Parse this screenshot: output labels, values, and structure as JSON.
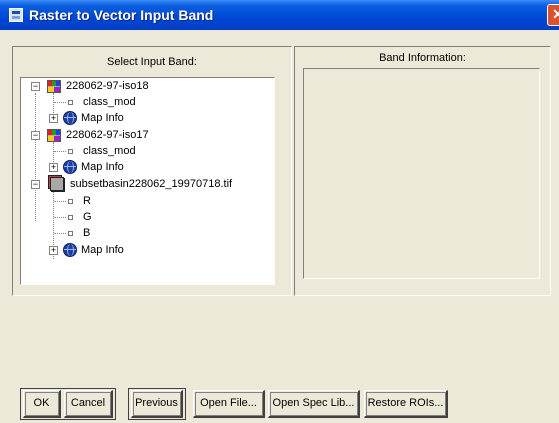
{
  "window": {
    "title": "Raster to Vector Input Band"
  },
  "left_panel": {
    "label": "Select Input Band:",
    "tree": [
      {
        "label": "228062-97-iso18",
        "type": "image"
      },
      {
        "label": "class_mod",
        "type": "band"
      },
      {
        "label": "Map Info",
        "type": "mapinfo"
      },
      {
        "label": "228062-97-iso17",
        "type": "image"
      },
      {
        "label": "class_mod",
        "type": "band"
      },
      {
        "label": "Map Info",
        "type": "mapinfo"
      },
      {
        "label": "subsetbasin228062_19970718.tif",
        "type": "file"
      },
      {
        "label": "R",
        "type": "band"
      },
      {
        "label": "G",
        "type": "band"
      },
      {
        "label": "B",
        "type": "band"
      },
      {
        "label": "Map Info",
        "type": "mapinfo"
      }
    ]
  },
  "right_panel": {
    "label": "Band Information:"
  },
  "buttons": {
    "ok": "OK",
    "cancel": "Cancel",
    "previous": "Previous",
    "open_file": "Open File...",
    "open_spec_lib": "Open Spec Lib...",
    "restore_rois": "Restore ROIs..."
  },
  "icons": {
    "close": "close-icon",
    "title": "app-icon",
    "image": "multiband-image-icon",
    "file": "raster-stack-icon",
    "map": "globe-icon"
  }
}
